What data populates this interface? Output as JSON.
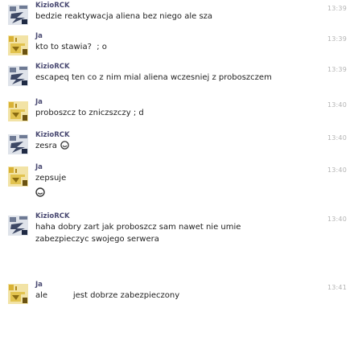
{
  "messages": [
    {
      "author": "KizioRCK",
      "lines": [
        "bedzie reaktywacja aliena bez niego ale sza"
      ],
      "time": "13:39",
      "avatar_icon": "bot-avatar-icon"
    },
    {
      "author": "Ja",
      "lines": [
        "kto to stawia?  ; o"
      ],
      "time": "13:39",
      "avatar_icon": "user-avatar-icon"
    },
    {
      "author": "KizioRCK",
      "lines": [
        "escapeq ten co z nim mial aliena wczesniej z proboszczem"
      ],
      "time": "13:39",
      "avatar_icon": "bot-avatar-icon"
    },
    {
      "author": "Ja",
      "lines": [
        "proboszcz to zniczszczy ; d"
      ],
      "time": "13:40",
      "avatar_icon": "user-avatar-icon"
    },
    {
      "author": "KizioRCK",
      "lines": [
        "zesra"
      ],
      "time": "13:40",
      "avatar_icon": "bot-avatar-icon",
      "emoji": "smile-emoji-icon"
    },
    {
      "author": "Ja",
      "lines": [
        "zepsuje"
      ],
      "time": "13:40",
      "avatar_icon": "user-avatar-icon",
      "emoji_line": "smile-emoji-icon"
    },
    {
      "author": "KizioRCK",
      "lines": [
        "haha dobry zart jak proboszcz sam nawet nie umie",
        "zabezpieczyc swojego serwera"
      ],
      "time": "13:40",
      "avatar_icon": "bot-avatar-icon"
    },
    {
      "author": "Ja",
      "lines": [
        "ale          jest dobrze zabezpieczony"
      ],
      "time": "13:41",
      "avatar_icon": "user-avatar-icon"
    }
  ],
  "colors": {
    "author": "#4a4a72",
    "text": "#1e1e1e",
    "time": "#b4b4b4",
    "bot_avatar": "#6e7a94",
    "user_avatar": "#d9b235"
  }
}
